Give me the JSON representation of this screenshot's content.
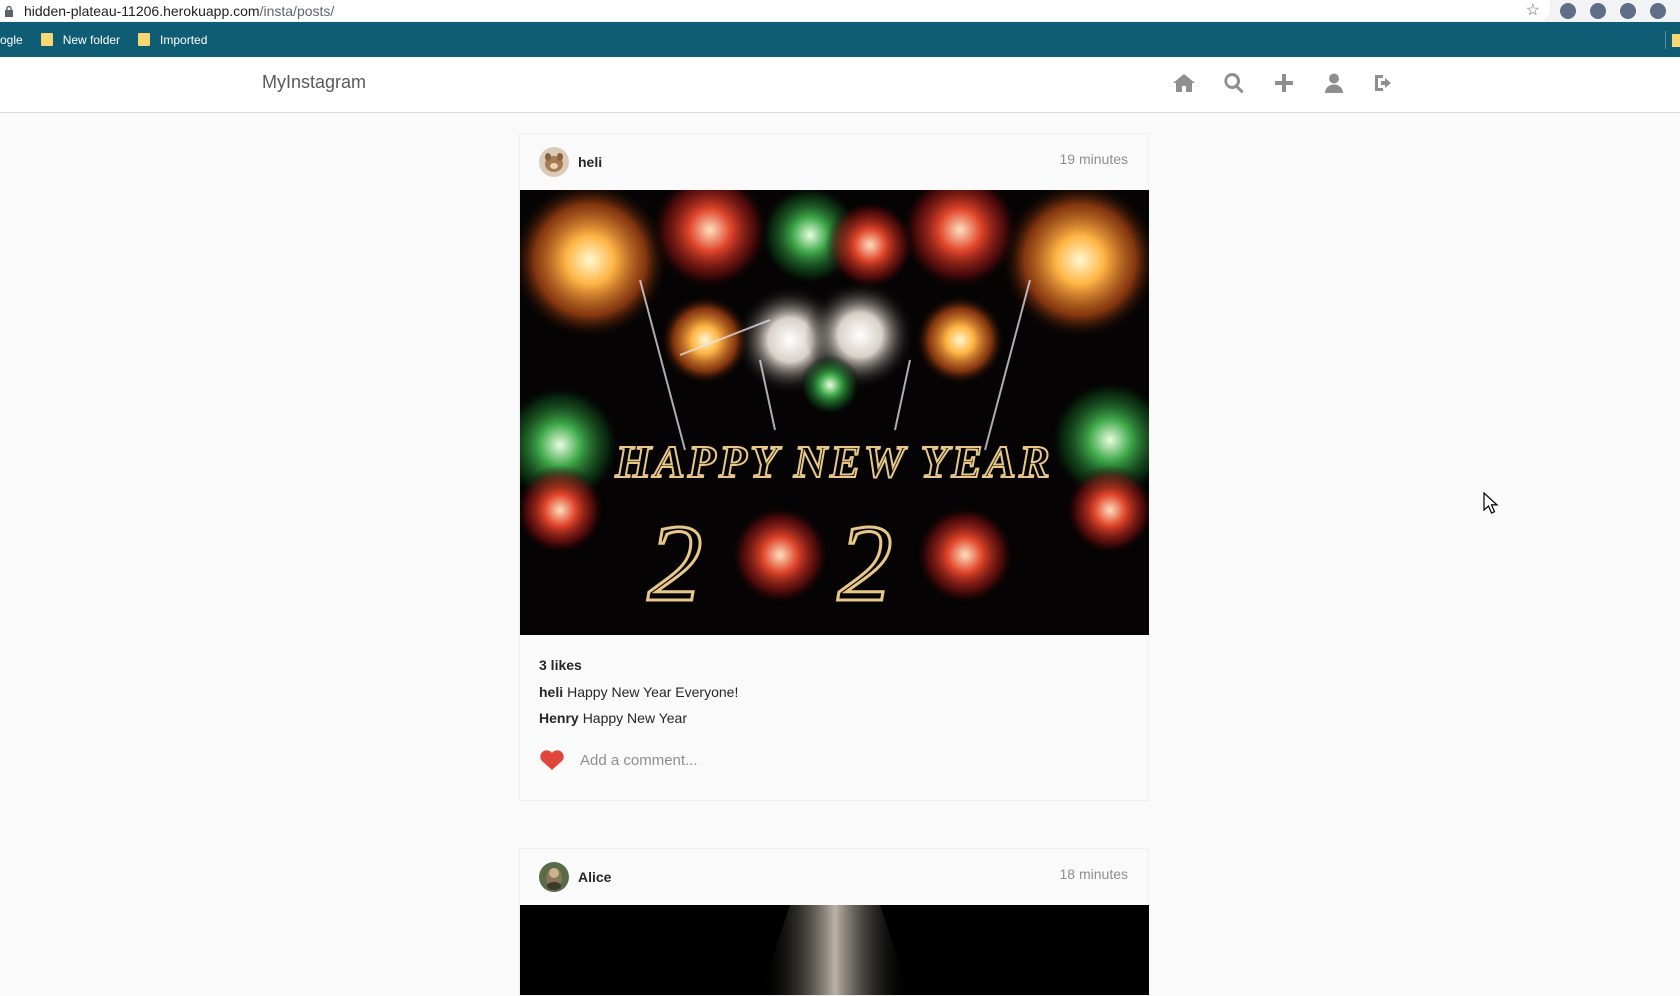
{
  "browser": {
    "url_host": "hidden-plateau-11206.herokuapp.com",
    "url_path": "/insta/posts/",
    "bookmarks": [
      {
        "label": "ogle"
      },
      {
        "label": "New folder"
      },
      {
        "label": "Imported"
      }
    ]
  },
  "app": {
    "brand": "MyInstagram",
    "nav": [
      {
        "icon": "home-icon"
      },
      {
        "icon": "search-icon"
      },
      {
        "icon": "plus-icon"
      },
      {
        "icon": "user-icon"
      },
      {
        "icon": "sign-out-icon"
      }
    ]
  },
  "posts": [
    {
      "username": "heli",
      "time": "19 minutes",
      "image_text": "HAPPY NEW YEAR",
      "image_digits": "2",
      "likes": "3 likes",
      "comments": [
        {
          "user": "heli",
          "text": "Happy New Year Everyone!"
        },
        {
          "user": "Henry",
          "text": "Happy New Year"
        }
      ],
      "comment_placeholder": "Add a comment...",
      "liked": true,
      "heart_color": "#e0463c"
    },
    {
      "username": "Alice",
      "time": "18 minutes"
    }
  ]
}
